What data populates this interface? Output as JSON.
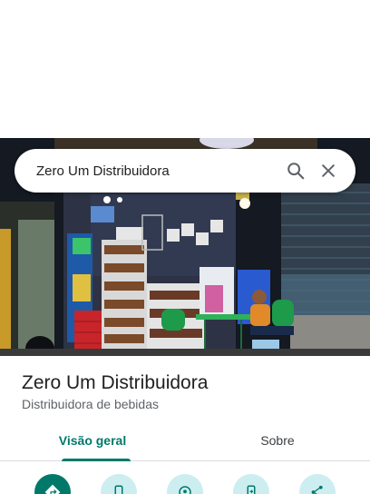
{
  "search": {
    "query": "Zero Um Distribuidora"
  },
  "place": {
    "name": "Zero Um Distribuidora",
    "category": "Distribuidora de bebidas"
  },
  "tabs": [
    {
      "label": "Visão geral",
      "active": true
    },
    {
      "label": "Sobre",
      "active": false
    }
  ],
  "actions": [
    {
      "icon": "directions-icon"
    },
    {
      "icon": "phone-icon"
    },
    {
      "icon": "location-save-icon"
    },
    {
      "icon": "send-to-phone-icon"
    },
    {
      "icon": "share-icon"
    }
  ],
  "colors": {
    "accent": "#00796b",
    "action_bg": "#cdeef0"
  }
}
